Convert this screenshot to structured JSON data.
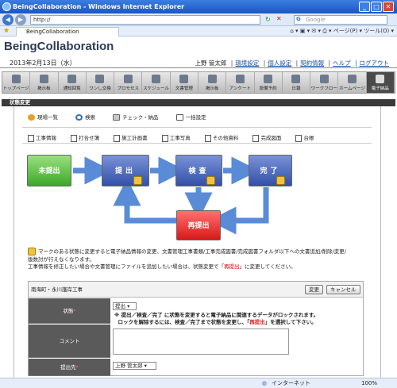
{
  "window": {
    "title": "BeingCollaboration - Windows Internet Explorer"
  },
  "browser": {
    "url": "http://",
    "search_placeholder": "Google",
    "tab_title": "BeingCollaboration",
    "tab_tools": "⌂ ▾  ▣ ▾  ✉ ▾  ⎙ ▾  ページ(P) ▾  ツール(O) ▾"
  },
  "app": {
    "title": "BeingCollaboration",
    "date": "2013年2月13日（水）",
    "user": "上野 管太郎",
    "links": [
      "環境設定",
      "個人設定",
      "契約情報",
      "ヘルプ",
      "ログアウト"
    ]
  },
  "menu": [
    {
      "label": "トップページ",
      "active": false
    },
    {
      "label": "掲示板",
      "active": false
    },
    {
      "label": "通知回覧",
      "active": false
    },
    {
      "label": "ワンし交換",
      "active": false
    },
    {
      "label": "プロモセス",
      "active": false
    },
    {
      "label": "スケジュール",
      "active": false
    },
    {
      "label": "文書管理",
      "active": false
    },
    {
      "label": "掲示板",
      "active": false
    },
    {
      "label": "アンケート",
      "active": false
    },
    {
      "label": "設備予約",
      "active": false
    },
    {
      "label": "日報",
      "active": false
    },
    {
      "label": "ワークフロー",
      "active": false
    },
    {
      "label": "ホームページ",
      "active": false
    },
    {
      "label": "電子納品",
      "active": true
    }
  ],
  "section": {
    "title": "状態変更"
  },
  "subnav": [
    {
      "label": "現場一覧",
      "color": "#e8a020"
    },
    {
      "label": "検索",
      "color": "#3a70c0"
    },
    {
      "label": "チェック・納品",
      "color": "#c8c8c8"
    },
    {
      "label": "一括設定",
      "color": "#e8e8e8"
    }
  ],
  "docnav": [
    "工事情報",
    "打合せ簿",
    "施工計画書",
    "工事写真",
    "その他資料",
    "完成図面",
    "台帳"
  ],
  "states": {
    "unsubmitted": "未提出",
    "submitted": "提出",
    "inspection": "検査",
    "completed": "完了",
    "resubmit": "再提出"
  },
  "notice": {
    "line1": "マークのある状態に変更すると電子納品情報の変更、文書管理工事書類/工事完成図書/完成図書フォルダ以下への文書追加/削除/変更/",
    "line2": "版数討が行えなくなります。",
    "line3_prefix": "工事情報を修正したい場合や文書管理にファイルを追加したい場合は、状態変更で「",
    "line3_red": "再提出",
    "line3_suffix": "」に変更してください。"
  },
  "form": {
    "project": "南海町・永川護岸工事",
    "buttons": {
      "change": "変更",
      "cancel": "キャンセル"
    },
    "status_label": "状態",
    "status_value": "提出",
    "status_note_1": "※ 提出／検査／完了 に状態を変更すると電子納品に関連するデータがロックされます。",
    "status_note_2_prefix": "ロックを解除するには、検査／完了まで状態を変更し、「",
    "status_note_2_red": "再提出",
    "status_note_2_suffix": "」を選択して下さい。",
    "comment_label": "コメント",
    "submit_to_label": "提出先",
    "submit_to_value": "上野 管太郎"
  },
  "statusbar": {
    "zone": "インターネット",
    "zoom": "100%"
  }
}
